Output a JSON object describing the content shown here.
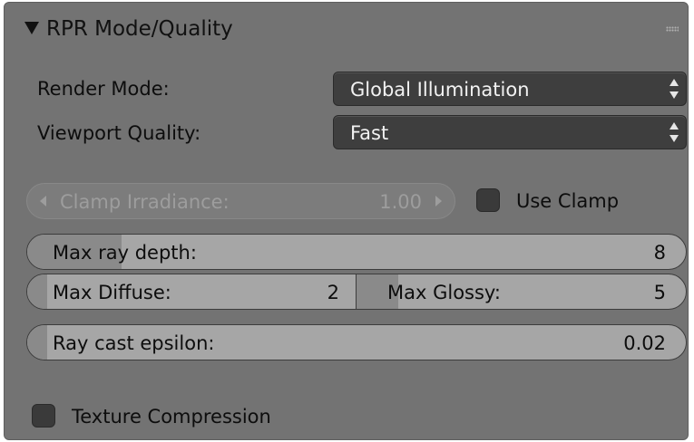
{
  "panel": {
    "title": "RPR Mode/Quality"
  },
  "render_mode": {
    "label": "Render Mode:",
    "value": "Global Illumination"
  },
  "viewport_quality": {
    "label": "Viewport Quality:",
    "value": "Fast"
  },
  "clamp_irradiance": {
    "label": "Clamp Irradiance:",
    "value": "1.00"
  },
  "use_clamp": {
    "label": "Use Clamp",
    "checked": false
  },
  "max_ray_depth": {
    "label": "Max ray depth:",
    "value": "8"
  },
  "max_diffuse": {
    "label": "Max Diffuse:",
    "value": "2"
  },
  "max_glossy": {
    "label": "Max Glossy:",
    "value": "5"
  },
  "ray_cast_epsilon": {
    "label": "Ray cast epsilon:",
    "value": "0.02"
  },
  "texture_compression": {
    "label": "Texture Compression",
    "checked": false
  }
}
